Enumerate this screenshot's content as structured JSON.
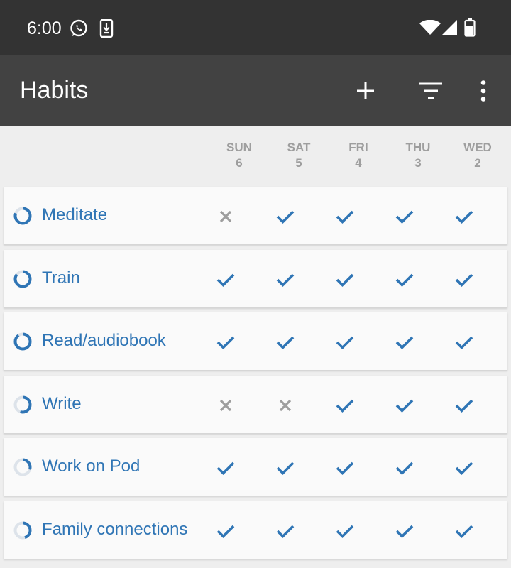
{
  "status_bar": {
    "time": "6:00",
    "icons": [
      "whatsapp-icon",
      "download-icon",
      "wifi-icon",
      "signal-icon",
      "battery-icon"
    ]
  },
  "app_bar": {
    "title": "Habits",
    "actions": [
      "add-icon",
      "filter-icon",
      "more-vert-icon"
    ]
  },
  "days": [
    {
      "day": "SUN",
      "date": "6"
    },
    {
      "day": "SAT",
      "date": "5"
    },
    {
      "day": "FRI",
      "date": "4"
    },
    {
      "day": "THU",
      "date": "3"
    },
    {
      "day": "WED",
      "date": "2"
    }
  ],
  "habits": [
    {
      "name": "Meditate",
      "score": 0.8,
      "checks": [
        false,
        true,
        true,
        true,
        true
      ]
    },
    {
      "name": "Train",
      "score": 0.85,
      "checks": [
        true,
        true,
        true,
        true,
        true
      ]
    },
    {
      "name": "Read/audiobook",
      "score": 0.9,
      "checks": [
        true,
        true,
        true,
        true,
        true
      ]
    },
    {
      "name": "Write",
      "score": 0.55,
      "checks": [
        false,
        false,
        true,
        true,
        true
      ]
    },
    {
      "name": "Work on Pod",
      "score": 0.3,
      "checks": [
        true,
        true,
        true,
        true,
        true
      ]
    },
    {
      "name": "Family connections",
      "score": 0.45,
      "checks": [
        true,
        true,
        true,
        true,
        true
      ]
    }
  ],
  "colors": {
    "accent": "#2f75b5",
    "ring_track": "#dde3ea",
    "unchecked": "#9e9e9e",
    "status_bar": "#333333",
    "app_bar": "#424242"
  }
}
